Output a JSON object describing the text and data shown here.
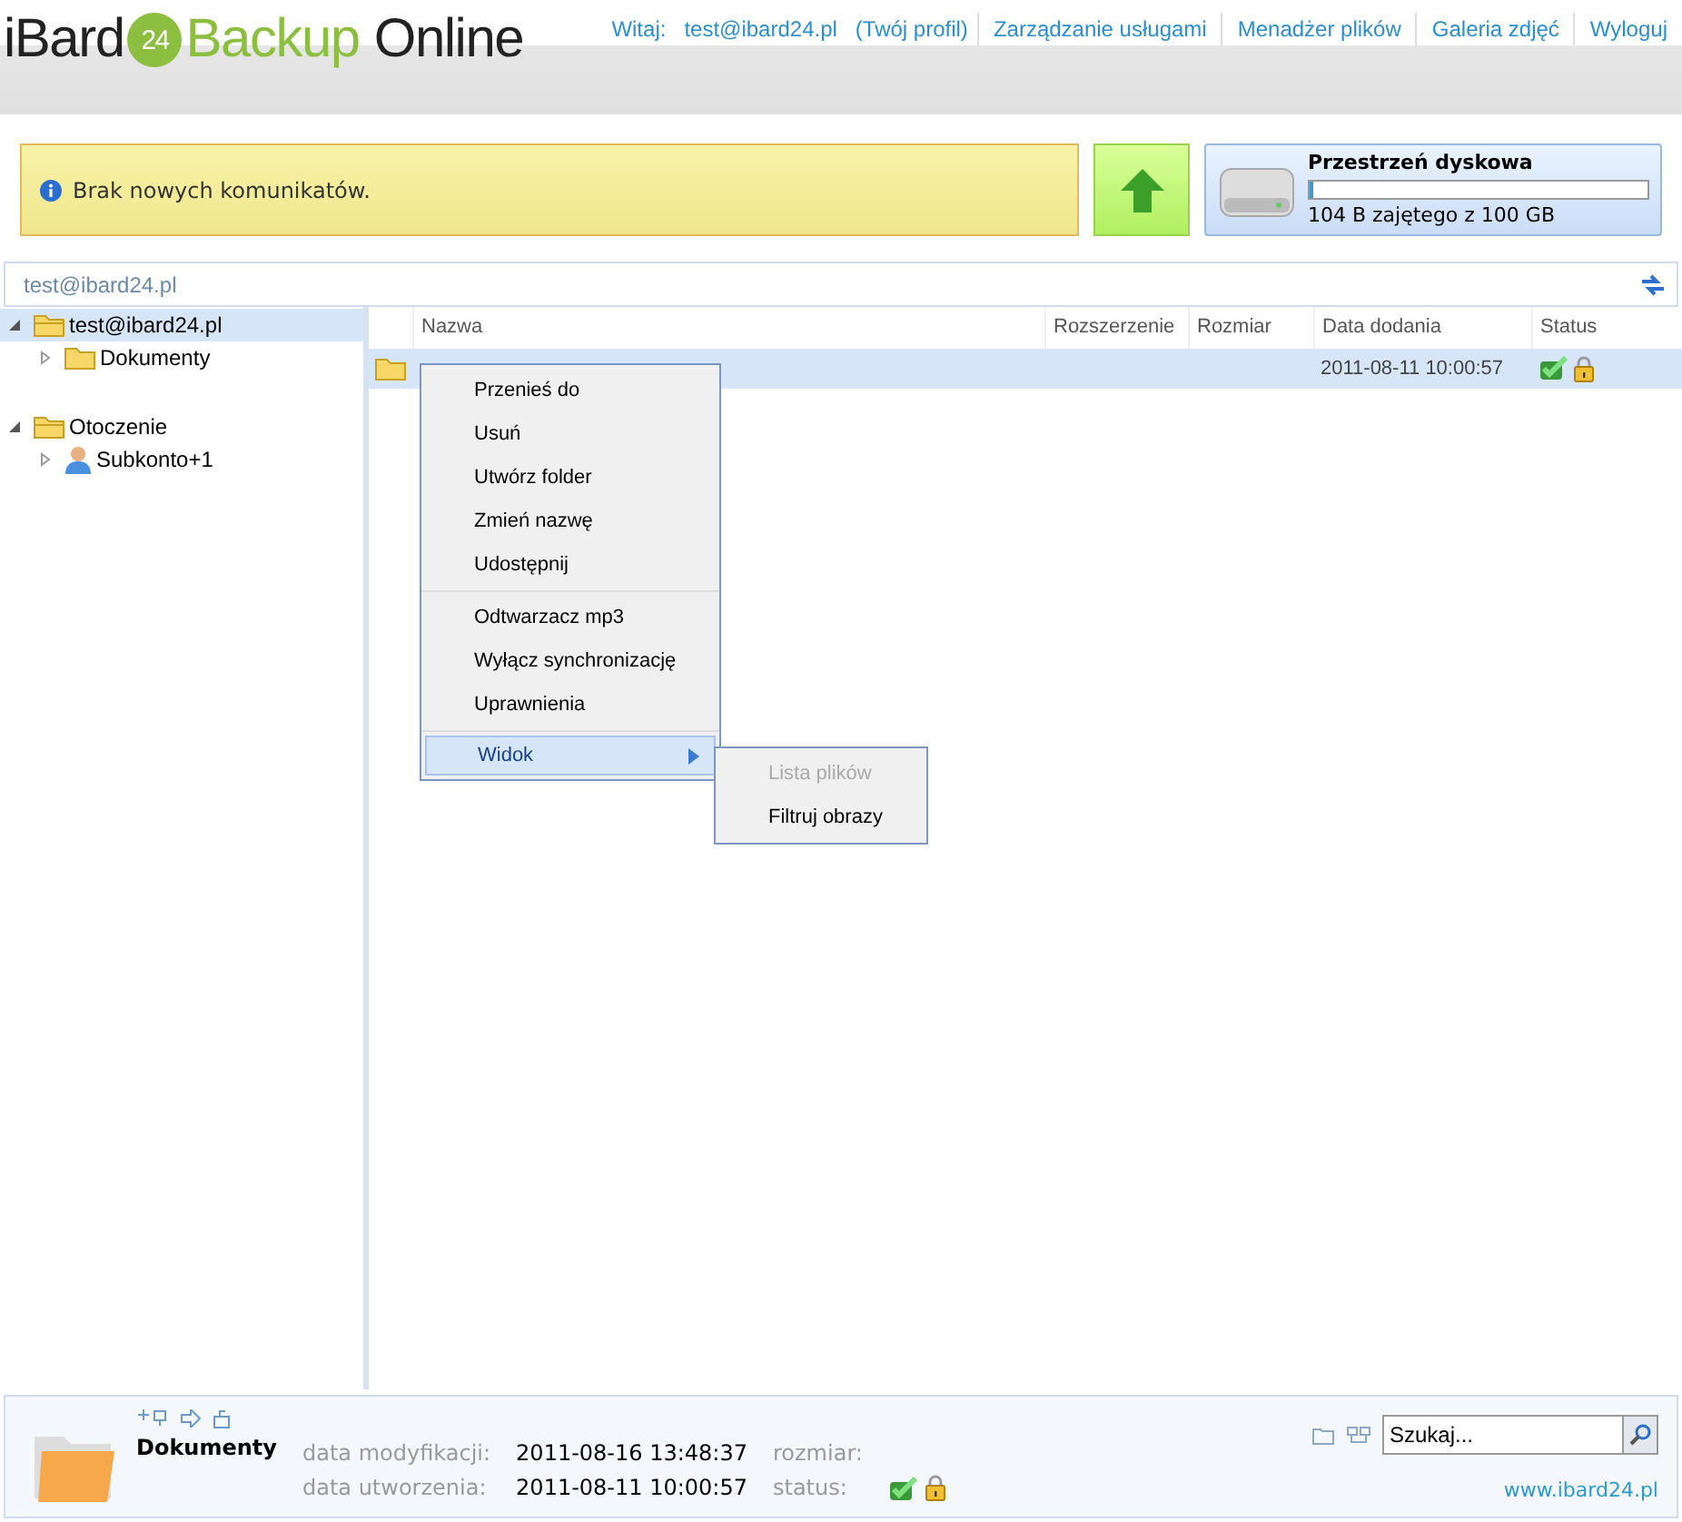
{
  "logo": {
    "left": "iBard",
    "badge": "24",
    "right": "Backup",
    "tail": "Online"
  },
  "nav": [
    {
      "label": "Witaj:"
    },
    {
      "label": "test@ibard24.pl"
    },
    {
      "label": "(Twój profil)"
    },
    {
      "label": "Zarządzanie usługami"
    },
    {
      "label": "Menadżer plików"
    },
    {
      "label": "Galeria zdjęć"
    },
    {
      "label": "Wyloguj"
    }
  ],
  "message": "Brak nowych komunikatów.",
  "disk": {
    "title": "Przestrzeń dyskowa",
    "level": 0.01,
    "reading": "104 B zajętego z 100 GB"
  },
  "breadcrumb": "test@ibard24.pl",
  "tree": [
    {
      "label": "test@ibard24.pl",
      "kind": "folder",
      "expanded": true,
      "selected": true,
      "children": [
        {
          "label": "Dokumenty",
          "kind": "folder",
          "expanded": false,
          "selected": false
        }
      ]
    },
    {
      "label": "Otoczenie",
      "kind": "folder",
      "expanded": true,
      "selected": false,
      "children": [
        {
          "label": "Subkonto+1",
          "kind": "user",
          "expanded": false,
          "selected": false
        }
      ]
    }
  ],
  "table": {
    "columns": [
      "Nazwa",
      "Rozszerzenie",
      "Rozmiar",
      "Data dodania",
      "Status"
    ],
    "rows": [
      {
        "date": "2011-08-11 10:00:57",
        "synced": true,
        "locked": true,
        "selected": true
      }
    ]
  },
  "context_menu": {
    "groups": [
      [
        "Przenieś do",
        "Usuń",
        "Utwórz folder",
        "Zmień nazwę",
        "Udostępnij"
      ],
      [
        "Odtwarzacz mp3",
        "Wyłącz synchronizację",
        "Uprawnienia"
      ]
    ],
    "submenu_item": {
      "label": "Widok",
      "selected": true
    },
    "submenu": [
      {
        "label": "Lista plików",
        "disabled": true
      },
      {
        "label": "Filtruj obrazy",
        "disabled": false
      }
    ]
  },
  "details": {
    "name": "Dokumenty",
    "fields": [
      {
        "label": "data modyfikacji:",
        "value": "2011-08-16 13:48:37"
      },
      {
        "label": "data utworzenia:",
        "value": "2011-08-11 10:00:57"
      }
    ],
    "size_label": "rozmiar:",
    "status_label": "status:",
    "synced": true,
    "locked": true
  },
  "search": {
    "value": "Szukaj..."
  },
  "footer_link": "www.ibard24.pl"
}
